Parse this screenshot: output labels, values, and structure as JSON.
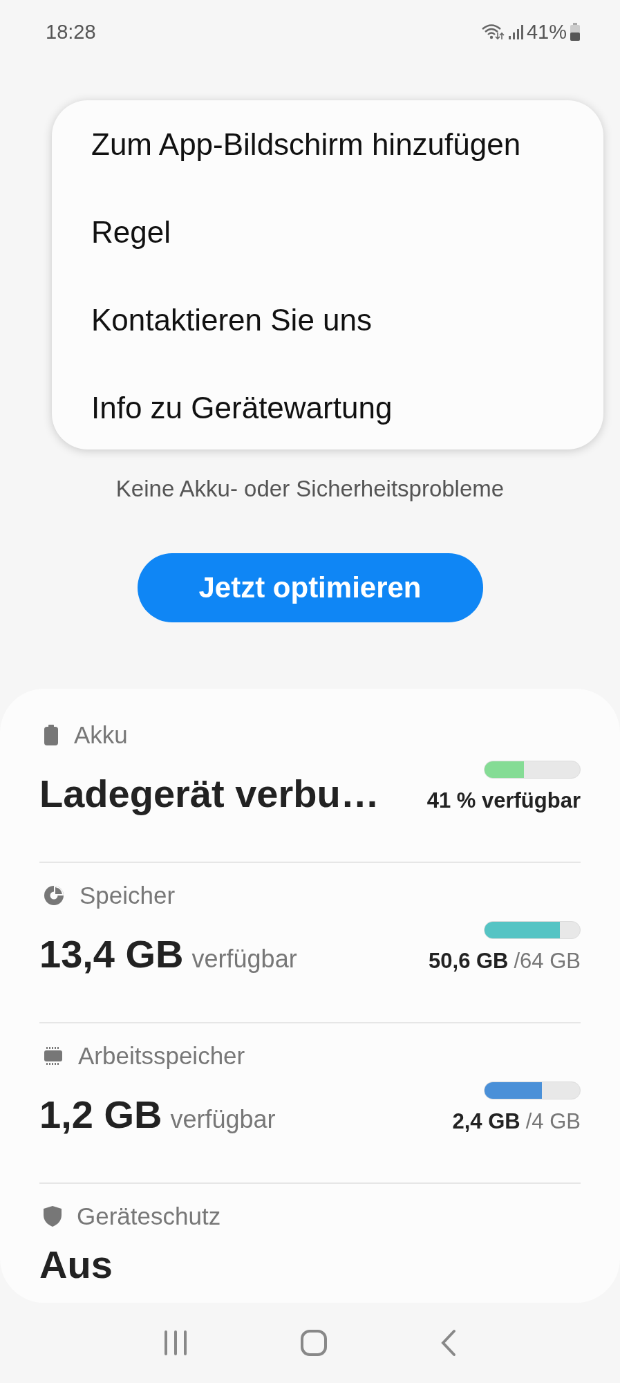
{
  "status_bar": {
    "time": "18:28",
    "battery": "41%"
  },
  "menu": {
    "items": [
      {
        "label": "Zum App-Bildschirm hinzufügen"
      },
      {
        "label": "Regel"
      },
      {
        "label": "Kontaktieren Sie uns"
      },
      {
        "label": "Info zu Gerätewartung"
      }
    ]
  },
  "status_text": "Keine Akku- oder Sicherheitsprobleme",
  "optimize_button": "Jetzt optimieren",
  "sections": [
    {
      "kind": "battery",
      "label": "Akku",
      "value": "Ladegerät verbu…",
      "level": 0.41,
      "color": "#85dc95",
      "reading": "41 % verfügbar"
    },
    {
      "kind": "storage",
      "label": "Speicher",
      "value": "13,4 GB",
      "unit": "verfügbar",
      "level": 0.79,
      "color": "#55c4c4",
      "used": "50,6 GB",
      "total": "/64 GB"
    },
    {
      "kind": "memory",
      "label": "Arbeitsspeicher",
      "value": "1,2 GB",
      "unit": "verfügbar",
      "level": 0.6,
      "color": "#4a90d8",
      "used": "2,4 GB",
      "total": "/4 GB"
    },
    {
      "kind": "shield",
      "label": "Geräteschutz",
      "value": "Aus"
    }
  ]
}
